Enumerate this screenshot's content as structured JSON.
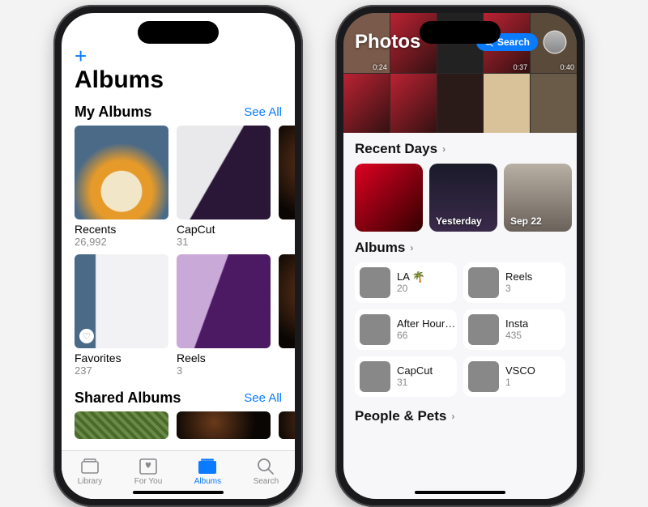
{
  "left": {
    "plus_label": "+",
    "title": "Albums",
    "my_albums_header": "My Albums",
    "see_all": "See All",
    "shared_albums_header": "Shared Albums",
    "albums_row1": [
      {
        "name": "Recents",
        "count": "26,992"
      },
      {
        "name": "CapCut",
        "count": "31"
      },
      {
        "name": "",
        "count": ""
      }
    ],
    "albums_row2": [
      {
        "name": "Favorites",
        "count": "237"
      },
      {
        "name": "Reels",
        "count": "3"
      },
      {
        "name": "",
        "count": ""
      }
    ],
    "tabs": {
      "library": "Library",
      "foryou": "For You",
      "albums": "Albums",
      "search": "Search"
    }
  },
  "right": {
    "hero_title": "Photos",
    "search_label": "Search",
    "durations": [
      "0:24",
      "",
      "",
      "0:37",
      "0:40",
      "",
      "",
      "",
      "",
      ""
    ],
    "recent_days_header": "Recent Days",
    "days": [
      {
        "label": ""
      },
      {
        "label": "Yesterday"
      },
      {
        "label": "Sep 22"
      },
      {
        "label": ""
      }
    ],
    "albums_header": "Albums",
    "album_cards": [
      {
        "name": "LA 🌴",
        "count": "20"
      },
      {
        "name": "Reels",
        "count": "3"
      },
      {
        "name": "After Hours Tour",
        "count": "66"
      },
      {
        "name": "Insta",
        "count": "435"
      },
      {
        "name": "CapCut",
        "count": "31"
      },
      {
        "name": "VSCO",
        "count": "1"
      }
    ],
    "people_header": "People & Pets"
  }
}
